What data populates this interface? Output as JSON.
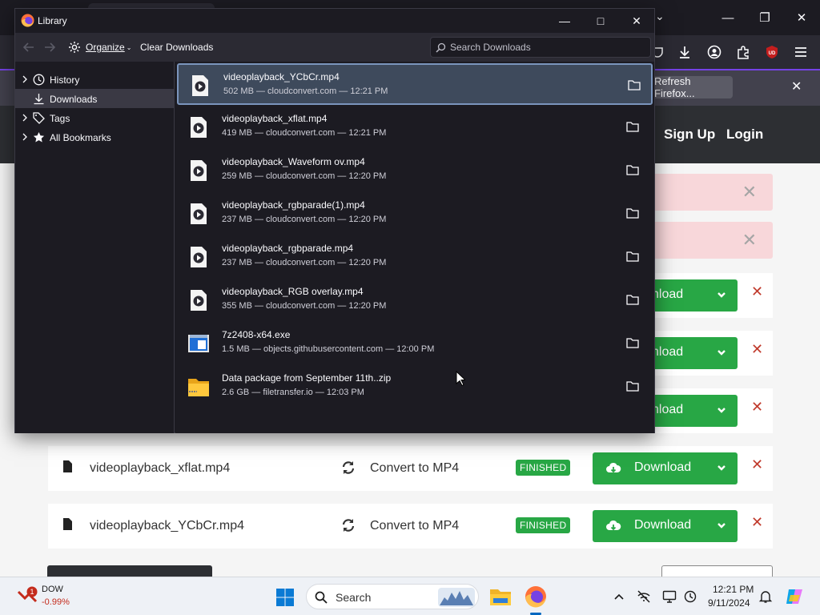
{
  "firefox": {
    "notification": {
      "refresh_label": "Refresh Firefox..."
    },
    "site": {
      "signup": "Sign Up",
      "login": "Login"
    },
    "rows": [
      {
        "filename": "videoplayback_xflat.mp4",
        "convert_label": "Convert to MP4",
        "status": "FINISHED",
        "download_label": "Download"
      },
      {
        "filename": "videoplayback_YCbCr.mp4",
        "convert_label": "Convert to MP4",
        "status": "FINISHED",
        "download_label": "Download"
      }
    ],
    "partial_download_labels": [
      "nload",
      "nload",
      "nload"
    ]
  },
  "library": {
    "title": "Library",
    "toolbar": {
      "organize": "Organize",
      "clear": "Clear Downloads",
      "search_placeholder": "Search Downloads"
    },
    "sidebar": [
      {
        "label": "History",
        "selected": false
      },
      {
        "label": "Downloads",
        "selected": true
      },
      {
        "label": "Tags",
        "selected": false
      },
      {
        "label": "All Bookmarks",
        "selected": false
      }
    ],
    "downloads": [
      {
        "name": "videoplayback_YCbCr.mp4",
        "meta": "502 MB — cloudconvert.com — 12:21 PM",
        "type": "video",
        "selected": true
      },
      {
        "name": "videoplayback_xflat.mp4",
        "meta": "419 MB — cloudconvert.com — 12:21 PM",
        "type": "video"
      },
      {
        "name": "videoplayback_Waveform ov.mp4",
        "meta": "259 MB — cloudconvert.com — 12:20 PM",
        "type": "video"
      },
      {
        "name": "videoplayback_rgbparade(1).mp4",
        "meta": "237 MB — cloudconvert.com — 12:20 PM",
        "type": "video"
      },
      {
        "name": "videoplayback_rgbparade.mp4",
        "meta": "237 MB — cloudconvert.com — 12:20 PM",
        "type": "video"
      },
      {
        "name": "videoplayback_RGB overlay.mp4",
        "meta": "355 MB — cloudconvert.com — 12:20 PM",
        "type": "video"
      },
      {
        "name": "7z2408-x64.exe",
        "meta": "1.5 MB — objects.githubusercontent.com — 12:00 PM",
        "type": "exe"
      },
      {
        "name": "Data package from September 11th..zip",
        "meta": "2.6 GB — filetransfer.io — 12:03 PM",
        "type": "zip"
      }
    ]
  },
  "taskbar": {
    "ticker_name": "DOW",
    "ticker_value": "-0.99%",
    "ticker_badge": "1",
    "search_label": "Search",
    "time": "12:21 PM",
    "date": "9/11/2024"
  },
  "colors": {
    "accent_green": "#28a745",
    "remove_red": "#c0392b",
    "library_bg": "#1c1b22",
    "selection": "#3e4a5c"
  }
}
